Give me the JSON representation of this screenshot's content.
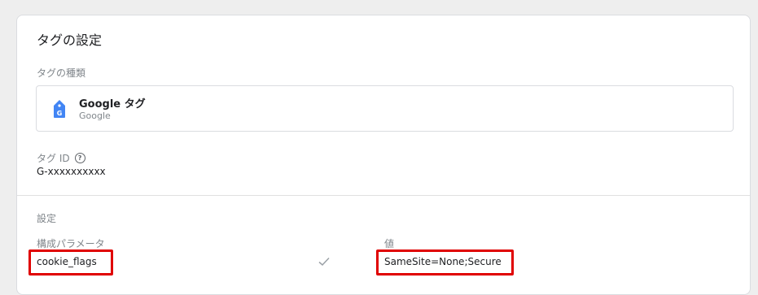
{
  "card": {
    "title": "タグの設定"
  },
  "tag_type": {
    "label": "タグの種類",
    "name": "Google タグ",
    "vendor": "Google",
    "icon": "google-tag-icon",
    "icon_color": "#4285f4"
  },
  "tag_id": {
    "label": "タグ ID",
    "help_glyph": "?",
    "value": "G-xxxxxxxxxx"
  },
  "settings": {
    "section_label": "設定",
    "param_column_label": "構成パラメータ",
    "value_column_label": "値",
    "rows": [
      {
        "name": "cookie_flags",
        "value": "SameSite=None;Secure"
      }
    ]
  },
  "highlight_color": "#e00000"
}
